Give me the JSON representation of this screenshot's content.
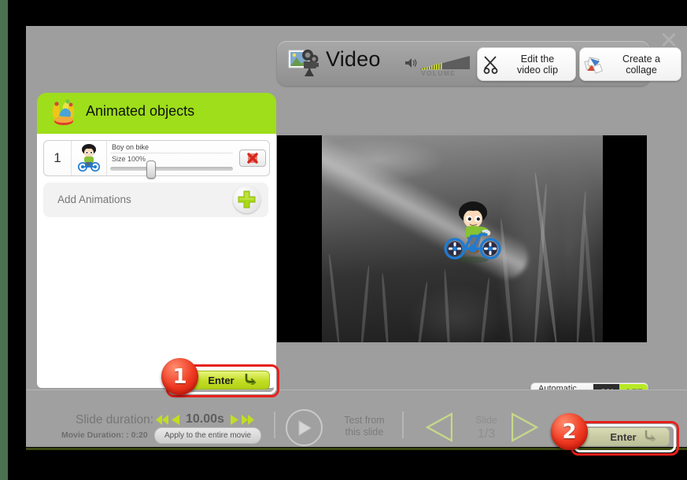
{
  "window": {
    "close_icon": "close-icon"
  },
  "toolbar": {
    "icon": "video-camera-icon",
    "title": "Video",
    "volume": {
      "icon": "speaker-icon",
      "label": "VOLUME"
    },
    "buttons": [
      {
        "icon": "scissors-icon",
        "label": "Edit the\nvideo clip",
        "line1": "Edit the",
        "line2": "video clip"
      },
      {
        "icon": "collage-icon",
        "label": "Create a\ncollage",
        "line1": "Create a",
        "line2": "collage"
      }
    ]
  },
  "left_panel": {
    "icon": "jester-hat-icon",
    "title": "Animated objects",
    "objects": [
      {
        "index": "1",
        "thumb_icon": "boy-on-bike-icon",
        "name": "Boy on bike",
        "size_label": "Size 100%",
        "size_value": 100,
        "delete_icon": "delete-icon"
      }
    ],
    "add_row": {
      "label": "Add Animations",
      "icon": "plus-icon"
    },
    "enter_button": {
      "label": "Enter",
      "arrow_icon": "arrow-down-right-icon",
      "badge": "1"
    }
  },
  "preview": {
    "sprite_icon": "boy-on-bike-sprite"
  },
  "crop_toggle": {
    "label": "Automatic crop",
    "on_label": "ON",
    "off_label": "OFF",
    "selected": "OFF"
  },
  "bottom_bar": {
    "slide_duration_label": "Slide duration:",
    "slide_duration_value": "10.00s",
    "nav_icons": {
      "prev_fast": "rewind-fast-icon",
      "prev": "rewind-icon",
      "next": "forward-icon",
      "next_fast": "forward-fast-icon"
    },
    "movie_duration_label": "Movie Duration: : 0:20",
    "apply_button_label": "Apply to the entire movie",
    "play_icon": "play-icon",
    "test_label_line1": "Test from",
    "test_label_line2": "this slide",
    "prev_slide_icon": "triangle-left-icon",
    "next_slide_icon": "triangle-right-icon",
    "slide_label": "Slide",
    "slide_counter": "1/3",
    "enter_button": {
      "label": "Enter",
      "arrow_icon": "arrow-down-right-icon",
      "badge": "2"
    }
  },
  "colors": {
    "accent_green": "#9ede1a",
    "badge_red": "#ef3a22",
    "toggle_off_green": "#b7e827",
    "window_gray": "#9e9e9e"
  }
}
